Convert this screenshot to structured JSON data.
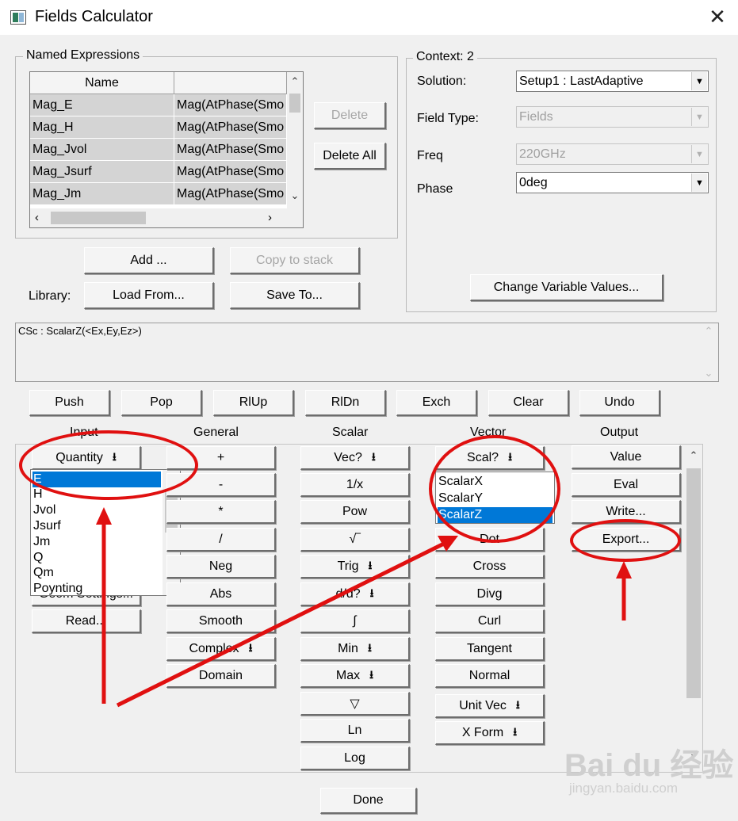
{
  "window": {
    "title": "Fields Calculator",
    "close_glyph": "✕"
  },
  "named_expressions": {
    "legend": "Named Expressions",
    "columns": [
      "Name",
      ""
    ],
    "rows": [
      {
        "name": "Mag_E",
        "expr": "Mag(AtPhase(Smo"
      },
      {
        "name": "Mag_H",
        "expr": "Mag(AtPhase(Smo"
      },
      {
        "name": "Mag_Jvol",
        "expr": "Mag(AtPhase(Smo"
      },
      {
        "name": "Mag_Jsurf",
        "expr": "Mag(AtPhase(Smo"
      },
      {
        "name": "Mag_Jm",
        "expr": "Mag(AtPhase(Smo"
      }
    ],
    "delete_label": "Delete",
    "delete_all_label": "Delete All",
    "add_label": "Add ...",
    "copy_to_stack_label": "Copy to stack",
    "library_label": "Library:",
    "load_from_label": "Load From...",
    "save_to_label": "Save To..."
  },
  "context": {
    "legend": "Context: 2",
    "solution_label": "Solution:",
    "solution_value": "Setup1 : LastAdaptive",
    "field_type_label": "Field Type:",
    "field_type_value": "Fields",
    "freq_label": "Freq",
    "freq_value": "220GHz",
    "phase_label": "Phase",
    "phase_value": "0deg",
    "change_vars_label": "Change Variable Values..."
  },
  "stack_text": "CSc : ScalarZ(<Ex,Ey,Ez>)",
  "stack_buttons": [
    "Push",
    "Pop",
    "RlUp",
    "RlDn",
    "Exch",
    "Clear",
    "Undo"
  ],
  "columns": {
    "input": "Input",
    "general": "General",
    "scalar": "Scalar",
    "vector": "Vector",
    "output": "Output"
  },
  "input": {
    "quantity_label": "Quantity",
    "quantity_options": [
      "E",
      "H",
      "Jvol",
      "Jsurf",
      "Jm",
      "Q",
      "Qm",
      "Poynting"
    ],
    "selected": "E",
    "geom_settings_label": "Geom Settings...",
    "read_label": "Read..."
  },
  "general": [
    "+",
    "-",
    "*",
    "/",
    "Neg",
    "Abs",
    "Smooth",
    "Complex",
    "Domain"
  ],
  "scalar": [
    "Vec?",
    "1/x",
    "Pow",
    "√‾",
    "Trig",
    "d/d?",
    "∫",
    "Min",
    "Max",
    "▽",
    "Ln",
    "Log"
  ],
  "vector": {
    "scal_label": "Scal?",
    "scal_options": [
      "ScalarX",
      "ScalarY",
      "ScalarZ"
    ],
    "selected": "ScalarZ",
    "buttons": [
      "Dot",
      "Cross",
      "Divg",
      "Curl",
      "Tangent",
      "Normal",
      "Unit Vec",
      "X Form"
    ]
  },
  "output": [
    "Value",
    "Eval",
    "Write...",
    "Export..."
  ],
  "done_label": "Done",
  "watermark": {
    "brand": "Bai du 经验",
    "url": "jingyan.baidu.com"
  },
  "colors": {
    "annotation": "#e01010",
    "selection": "#0078d7"
  }
}
